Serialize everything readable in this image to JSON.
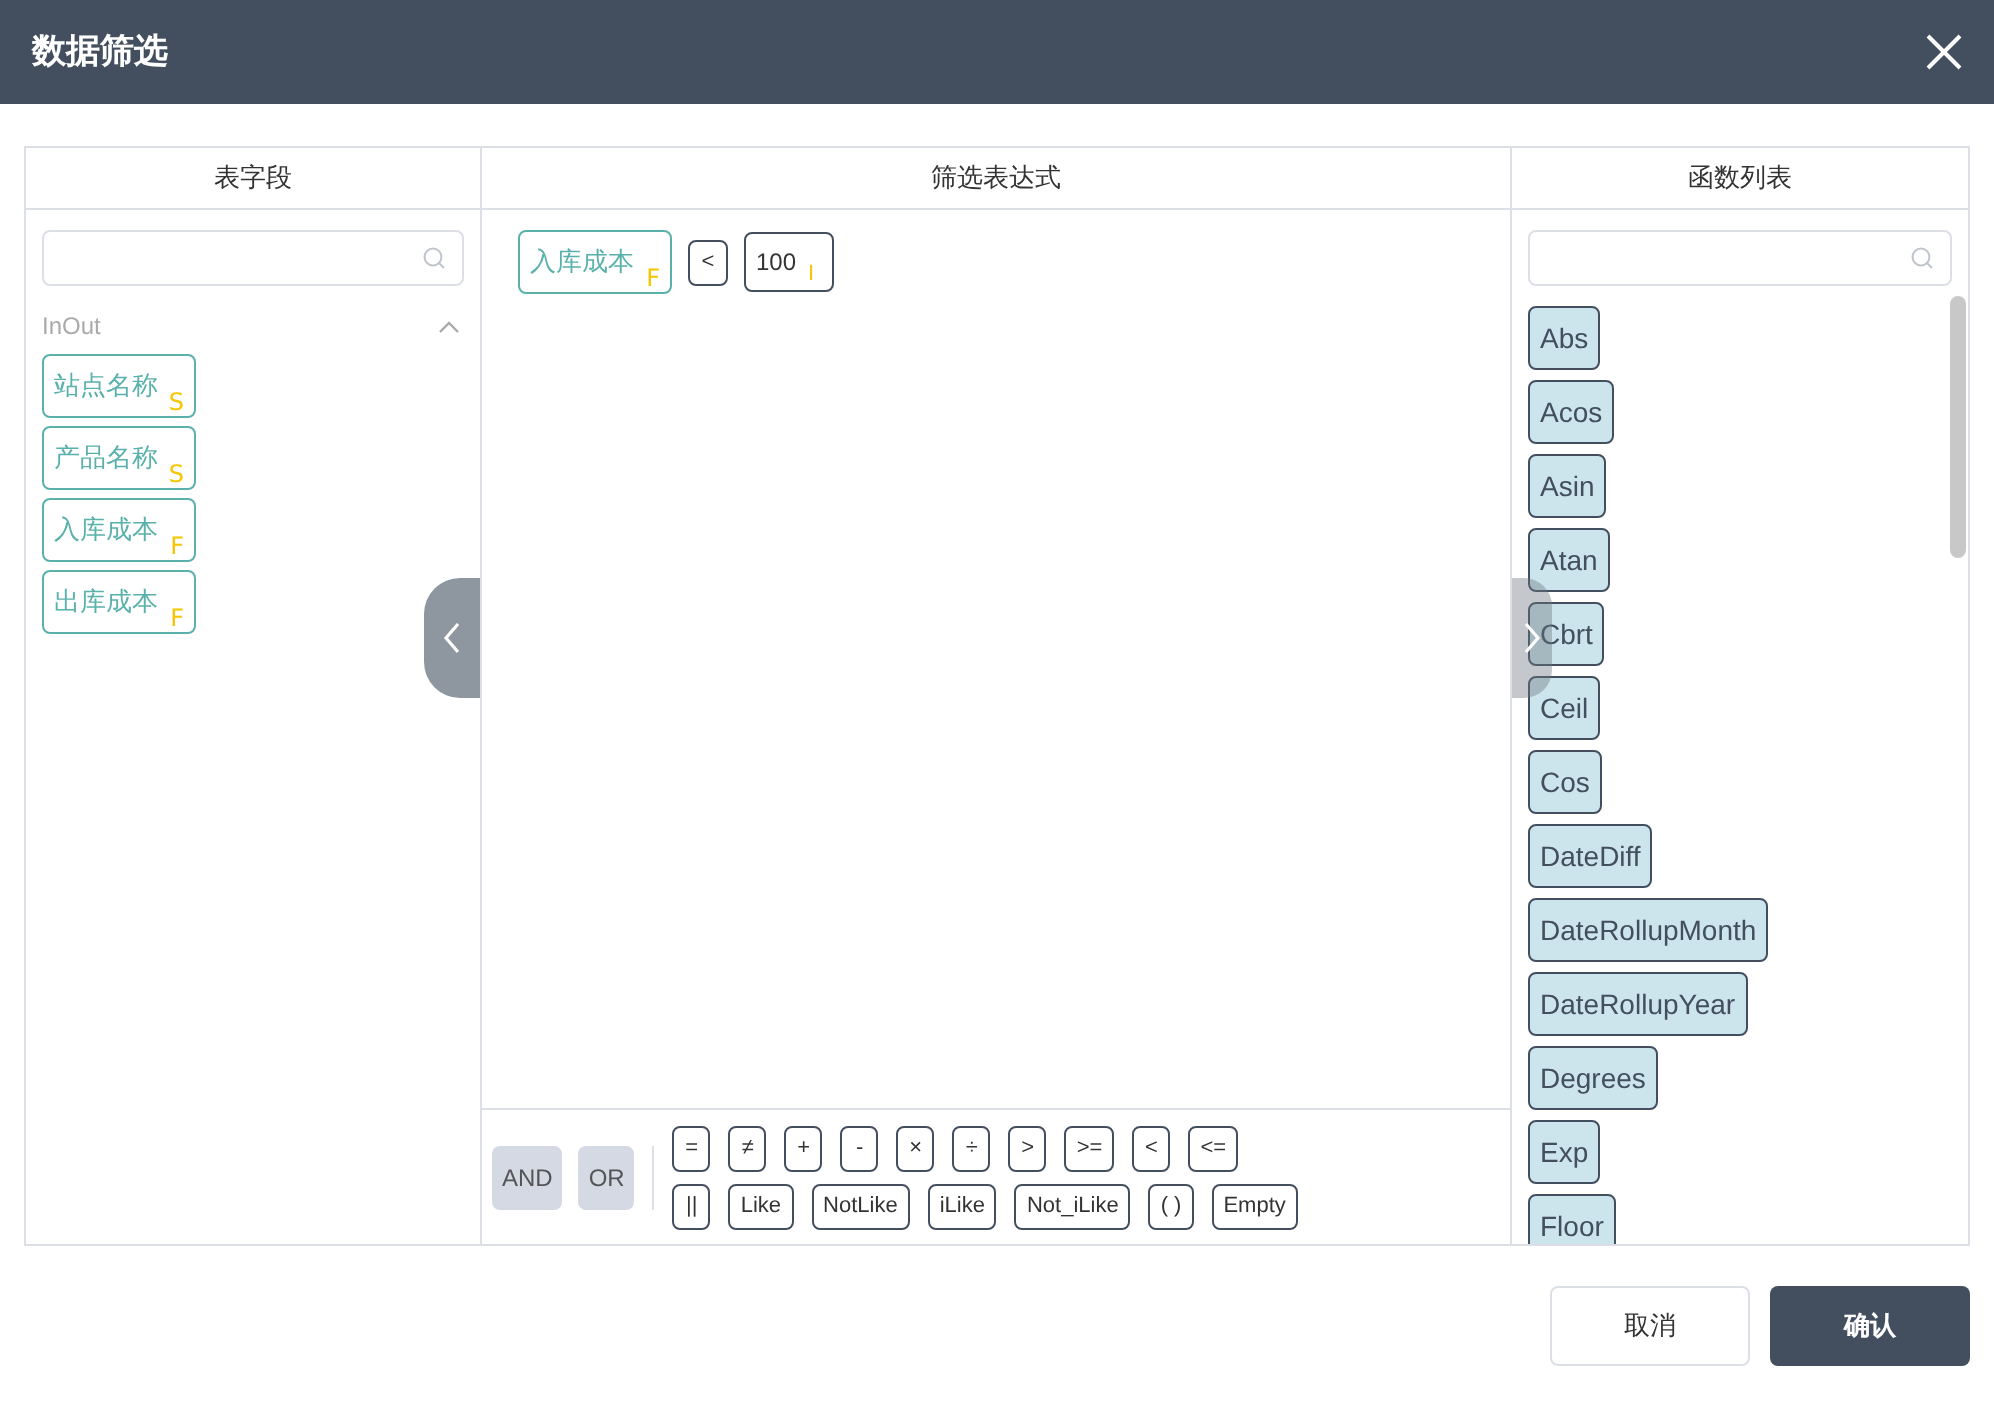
{
  "window": {
    "title": "数据筛选"
  },
  "fields_panel": {
    "title": "表字段",
    "group": {
      "name": "InOut",
      "expanded": true,
      "fields": [
        {
          "label": "站点名称",
          "type": "S"
        },
        {
          "label": "产品名称",
          "type": "S"
        },
        {
          "label": "入库成本",
          "type": "F"
        },
        {
          "label": "出库成本",
          "type": "F"
        }
      ]
    }
  },
  "expression_panel": {
    "title": "筛选表达式",
    "tokens": [
      {
        "kind": "field",
        "label": "入库成本",
        "type": "F"
      },
      {
        "kind": "operator",
        "label": "<"
      },
      {
        "kind": "value",
        "label": "100",
        "type": "I"
      }
    ],
    "logic_buttons": [
      "AND",
      "OR"
    ],
    "operator_rows": [
      [
        "=",
        "≠",
        "+",
        "-",
        "×",
        "÷",
        ">",
        ">=",
        "<",
        "<="
      ],
      [
        "||",
        "Like",
        "NotLike",
        "iLike",
        "Not_iLike",
        "( )",
        "Empty"
      ]
    ]
  },
  "functions_panel": {
    "title": "函数列表",
    "functions": [
      "Abs",
      "Acos",
      "Asin",
      "Atan",
      "Cbrt",
      "Ceil",
      "Cos",
      "DateDiff",
      "DateRollupMonth",
      "DateRollupYear",
      "Degrees",
      "Exp",
      "Floor"
    ]
  },
  "buttons": [
    {
      "label": "取消",
      "kind": "secondary"
    },
    {
      "label": "确认",
      "kind": "primary"
    }
  ]
}
